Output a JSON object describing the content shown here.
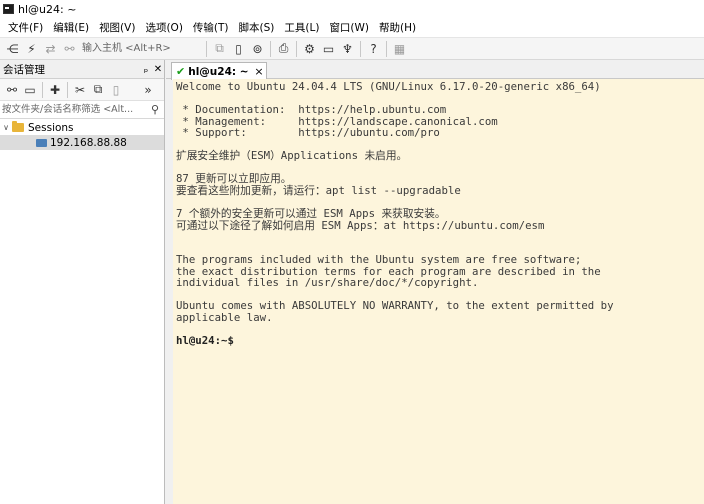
{
  "window": {
    "title": "hl@u24: ~"
  },
  "menu": [
    "文件(F)",
    "编辑(E)",
    "视图(V)",
    "选项(O)",
    "传输(T)",
    "脚本(S)",
    "工具(L)",
    "窗口(W)",
    "帮助(H)"
  ],
  "toolbar": {
    "host_placeholder": "输入主机 <Alt+R>",
    "icons": [
      "connect-icon",
      "quick-connect-icon",
      "reconnect-icon",
      "disconnect-icon",
      "copy-icon",
      "paste-icon",
      "find-icon",
      "print-icon",
      "settings-icon",
      "keymap-icon",
      "key-icon",
      "help-icon",
      "screen-icon"
    ]
  },
  "sidebar": {
    "title": "会话管理",
    "pin": "ₚ",
    "close": "✕",
    "more": "»",
    "filter_placeholder": "按文件夹/会话名称筛选 <Alt...",
    "tree": {
      "root": "Sessions",
      "items": [
        {
          "label": "192.168.88.88",
          "selected": true
        }
      ]
    }
  },
  "tab": {
    "label": "hl@u24: ~",
    "close": "×"
  },
  "terminal": {
    "lines": [
      "Welcome to Ubuntu 24.04.4 LTS (GNU/Linux 6.17.0-20-generic x86_64)",
      "",
      " * Documentation:  https://help.ubuntu.com",
      " * Management:     https://landscape.canonical.com",
      " * Support:        https://ubuntu.com/pro",
      "",
      "扩展安全维护（ESM）Applications 未启用。",
      "",
      "87 更新可以立即应用。",
      "要查看这些附加更新，请运行：apt list --upgradable",
      "",
      "7 个额外的安全更新可以通过 ESM Apps 来获取安装。",
      "可通过以下途径了解如何启用 ESM Apps：at https://ubuntu.com/esm",
      "",
      "",
      "The programs included with the Ubuntu system are free software;",
      "the exact distribution terms for each program are described in the",
      "individual files in /usr/share/doc/*/copyright.",
      "",
      "Ubuntu comes with ABSOLUTELY NO WARRANTY, to the extent permitted by",
      "applicable law.",
      ""
    ],
    "prompt": "hl@u24:~$"
  }
}
